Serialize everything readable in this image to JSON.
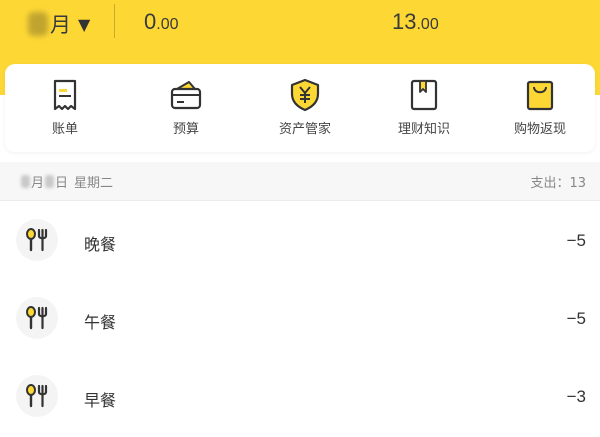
{
  "header": {
    "month_label": "月",
    "income_int": "0",
    "income_dec": ".00",
    "expense_int": "13",
    "expense_dec": ".00",
    "background_color": "#fdd835"
  },
  "quick_menu": [
    {
      "label": "账单",
      "icon": "bill-icon"
    },
    {
      "label": "预算",
      "icon": "budget-wallet-icon"
    },
    {
      "label": "资产管家",
      "icon": "yuan-shield-icon"
    },
    {
      "label": "理财知识",
      "icon": "bookmark-book-icon"
    },
    {
      "label": "购物返现",
      "icon": "shopping-bag-icon"
    }
  ],
  "day": {
    "month_suffix": "月",
    "day_suffix": "日",
    "weekday": "星期二",
    "expense_label": "支出：13"
  },
  "records": [
    {
      "name": "晚餐",
      "amount": "−5",
      "icon": "fork-spoon-icon"
    },
    {
      "name": "午餐",
      "amount": "−5",
      "icon": "fork-spoon-icon"
    },
    {
      "name": "早餐",
      "amount": "−3",
      "icon": "fork-spoon-icon"
    }
  ],
  "accent_color": "#fdd835"
}
